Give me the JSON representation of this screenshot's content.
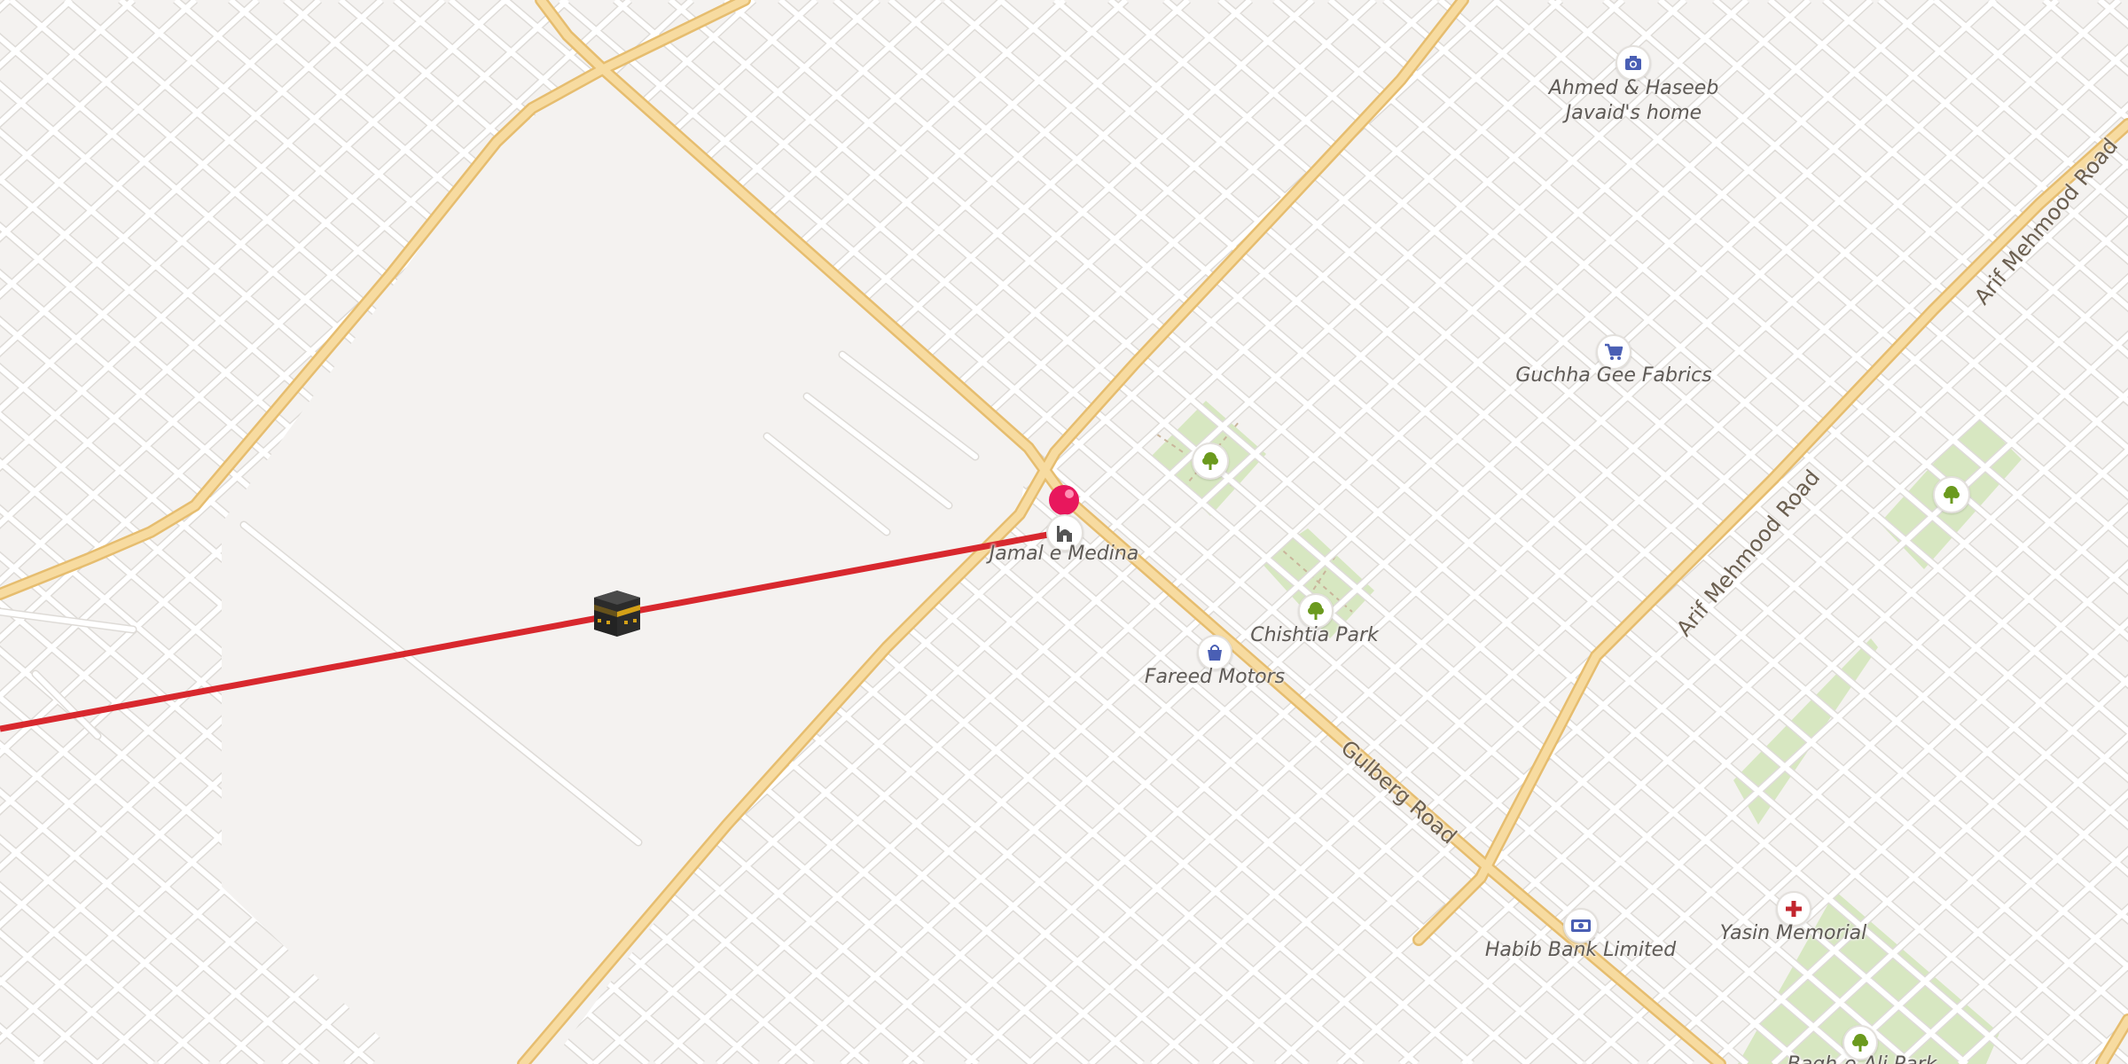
{
  "colors": {
    "background": "#f4f2f0",
    "street": "#ffffff",
    "street_casing": "#dedbd7",
    "major_road": "#f5d79a",
    "major_road_casing": "#e6bd6f",
    "park": "#d7e7c1",
    "qibla_line": "#d8282e",
    "pin": "#e8175d",
    "poi_icon_blue": "#4a5fb4",
    "poi_icon_green": "#6b9a1e",
    "poi_icon_red": "#c2262e"
  },
  "roads": {
    "gulberg_road": "Gulberg Road",
    "arif_mehmood_road_upper": "Arif Mehmood Road",
    "arif_mehmood_road_lower": "Arif Mehmood Road"
  },
  "pois": {
    "ahmed_haseeb_home": {
      "line1": "Ahmed & Haseeb",
      "line2": "Javaid's home",
      "icon": "camera-icon"
    },
    "guchha_gee_fabrics": {
      "label": "Guchha Gee Fabrics",
      "icon": "shopping-cart-icon"
    },
    "jamal_e_medina": {
      "label": "Jamal e Medina",
      "icon": "mosque-icon"
    },
    "chishtia_park": {
      "label": "Chishtia Park",
      "icon": "tree-icon"
    },
    "fareed_motors": {
      "label": "Fareed Motors",
      "icon": "shopping-bag-icon"
    },
    "habib_bank": {
      "label": "Habib Bank Limited",
      "icon": "banknote-icon"
    },
    "yasin_memorial": {
      "label": "Yasin Memorial",
      "icon": "red-cross-icon"
    },
    "east_park": {
      "icon": "tree-icon"
    },
    "bottom_park": {
      "label": "Bagh-e-Ali Park",
      "icon": "tree-icon"
    }
  },
  "markers": {
    "location_pin": "location-pin-icon",
    "kaaba": "kaaba-icon"
  }
}
